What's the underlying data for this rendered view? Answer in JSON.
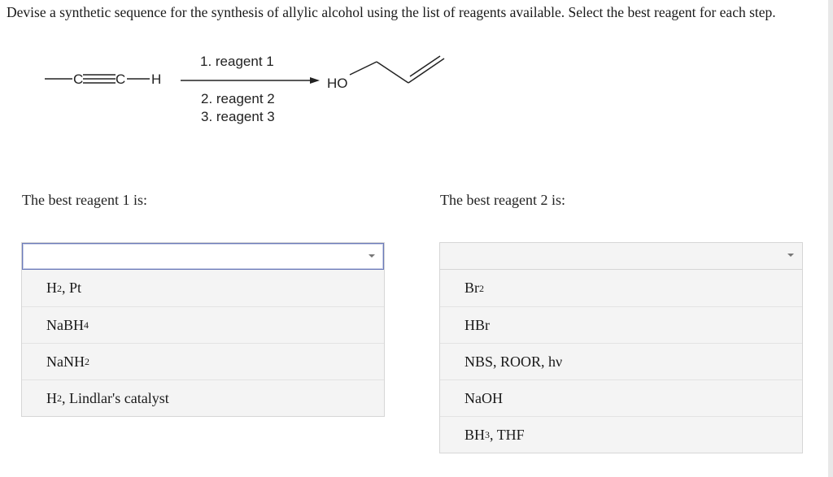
{
  "question": "Devise a synthetic sequence for the synthesis of allylic alcohol using the list of reagents available. Select the best reagent for each step.",
  "scheme": {
    "reactant": {
      "c1": "C",
      "c2": "C",
      "h": "H"
    },
    "conditions": {
      "step1": "1. reagent 1",
      "step2": "2. reagent 2",
      "step3": "3. reagent 3"
    },
    "product_ho": "HO"
  },
  "reagent1": {
    "prompt": "The best reagent 1 is:",
    "selected": "",
    "options": [
      {
        "main": "H",
        "sub": "2",
        "rest": ", Pt"
      },
      {
        "main": "NaBH",
        "sub": "4",
        "rest": ""
      },
      {
        "main": "NaNH",
        "sub": "2",
        "rest": ""
      },
      {
        "main": "H",
        "sub": "2",
        "rest": ", Lindlar's catalyst"
      }
    ]
  },
  "reagent2": {
    "prompt": "The best reagent 2 is:",
    "selected": "",
    "options": [
      {
        "main": "Br",
        "sub": "2",
        "rest": ""
      },
      {
        "main": "HBr",
        "sub": "",
        "rest": ""
      },
      {
        "main": "NBS, ROOR, hν",
        "sub": "",
        "rest": ""
      },
      {
        "main": "NaOH",
        "sub": "",
        "rest": ""
      },
      {
        "main": "BH",
        "sub": "3",
        "rest": ", THF"
      }
    ]
  }
}
